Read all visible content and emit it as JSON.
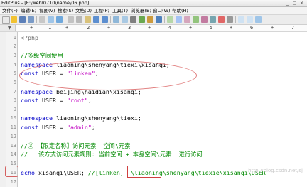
{
  "window": {
    "title_parts": [
      "EditPlus",
      "-",
      "[E:\\web\\0710\\name\\06.php]"
    ],
    "buttons": [
      "_",
      "□",
      "×"
    ]
  },
  "menu": [
    "文件(F)",
    "编辑(E)",
    "视图(V)",
    "搜索(S)",
    "文档(D)",
    "工程(P)",
    "工具(T)",
    "浏览器(B)",
    "窗口(W)",
    "帮助(H)"
  ],
  "ruler": {
    "gutter_marker": "▼",
    "marks": [
      "+",
      "1",
      "+",
      "2",
      "+",
      "3",
      "+",
      "4",
      "+",
      "5",
      "+",
      "6",
      "+",
      "7"
    ]
  },
  "code_lines": [
    {
      "n": "1",
      "tokens": [
        {
          "t": "<?php",
          "c": "tag"
        }
      ]
    },
    {
      "n": "2",
      "tokens": []
    },
    {
      "n": "3",
      "tokens": [
        {
          "t": "//多级空间使用",
          "c": "cmt"
        }
      ]
    },
    {
      "n": "4",
      "tokens": [
        {
          "t": "namespace",
          "c": "key"
        },
        {
          "t": " liaoning\\shenyang\\tiexi\\xisanqi;",
          "c": "plain"
        }
      ]
    },
    {
      "n": "5",
      "tokens": [
        {
          "t": "const",
          "c": "key"
        },
        {
          "t": " USER = ",
          "c": "plain"
        },
        {
          "t": "\"linken\"",
          "c": "str"
        },
        {
          "t": ";",
          "c": "plain"
        }
      ]
    },
    {
      "n": "6",
      "tokens": []
    },
    {
      "n": "7",
      "tokens": [
        {
          "t": "namespace",
          "c": "key"
        },
        {
          "t": " beijing\\haidian\\xisanqi;",
          "c": "plain"
        }
      ]
    },
    {
      "n": "8",
      "tokens": [
        {
          "t": "const",
          "c": "key"
        },
        {
          "t": " USER = ",
          "c": "plain"
        },
        {
          "t": "\"root\"",
          "c": "str"
        },
        {
          "t": ";",
          "c": "plain"
        }
      ]
    },
    {
      "n": "9",
      "tokens": []
    },
    {
      "n": "10",
      "tokens": [
        {
          "t": "namespace",
          "c": "key"
        },
        {
          "t": " liaoning\\shenyang\\tiexi;",
          "c": "plain"
        }
      ]
    },
    {
      "n": "11",
      "tokens": [
        {
          "t": "const",
          "c": "key"
        },
        {
          "t": " USER = ",
          "c": "plain"
        },
        {
          "t": "\"admin\"",
          "c": "str"
        },
        {
          "t": ";",
          "c": "plain"
        }
      ]
    },
    {
      "n": "12",
      "tokens": []
    },
    {
      "n": "13",
      "tokens": [
        {
          "t": "//③ 【限定名称】访问元素  空间\\元素",
          "c": "cmt"
        }
      ]
    },
    {
      "n": "14",
      "tokens": [
        {
          "t": "//   该方式访问元素规则: 当前空间 + 本身空间\\元素  进行访问",
          "c": "cmt"
        }
      ]
    },
    {
      "n": "15",
      "tokens": []
    },
    {
      "n": "16",
      "tokens": [
        {
          "t": "echo",
          "c": "key"
        },
        {
          "t": " xisanqi\\USER; ",
          "c": "plain"
        },
        {
          "t": "//[linken]  \\liaoning\\shenyang\\tiexie\\xisanqi\\USER",
          "c": "cmt"
        }
      ]
    },
    {
      "n": "17",
      "tokens": []
    }
  ],
  "watermark": "http://blog.csdn.net/sj",
  "colors": {
    "keyword": "#0000c8",
    "string": "#c000c0",
    "comment": "#008a00",
    "annotation": "#d04040"
  }
}
